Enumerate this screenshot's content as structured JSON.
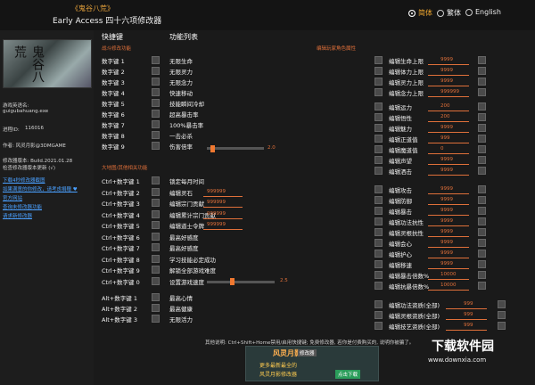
{
  "header": {
    "game_title": "《鬼谷八荒》",
    "subtitle": "Early Access 四十六项修改器",
    "langs": [
      {
        "label": "简体",
        "selected": true
      },
      {
        "label": "繁体",
        "selected": false
      },
      {
        "label": "English",
        "selected": false
      }
    ]
  },
  "sidebar": {
    "logo_text": "鬼谷八荒",
    "game_en_label": "游戏英语名:",
    "game_en_value": "guigubahuang.exe",
    "pid_label": "进程ID:",
    "pid_value": "116016",
    "author": "作者: 风灵月影@3DMGAME",
    "version": "修改器版本: Build.2021.01.28",
    "version_check": "检查修改器版本更新 (√)",
    "links": [
      "下载4秒修改器截图",
      "如果满意的你修改，请考虑捐赠 ♥",
      "官方网站",
      "查询未修改器功能",
      "请求新修改器"
    ]
  },
  "tabs": {
    "hotkeys": "快捷键",
    "features": "功能列表"
  },
  "sections": {
    "combat": "战斗修改功能",
    "player": "编辑玩家角色属性",
    "map": "大地图/其他相关功能"
  },
  "combat_keys": [
    "数字键 1",
    "数字键 2",
    "数字键 3",
    "数字键 4",
    "数字键 5",
    "数字键 6",
    "数字键 7",
    "数字键 8",
    "数字键 9"
  ],
  "combat_labels": [
    "无限生命",
    "无限灵力",
    "无限念力",
    "快速移动",
    "技能瞬间冷却",
    "超高暴击率",
    "100%暴击率",
    "一击必杀",
    "伤害倍率"
  ],
  "combat_slider_value": "2.0",
  "map_keys": [
    "Ctrl+数字键 1",
    "Ctrl+数字键 2",
    "Ctrl+数字键 3",
    "Ctrl+数字键 4",
    "Ctrl+数字键 5",
    "Ctrl+数字键 6",
    "Ctrl+数字键 7",
    "Ctrl+数字键 8",
    "Ctrl+数字键 9",
    "Ctrl+数字键 0"
  ],
  "map_labels": [
    "锁定每月时间",
    "编辑灵石",
    "编辑宗门贡献",
    "编辑累计宗门贡献",
    "编辑道士令牌",
    "最高好感度",
    "最高好感度",
    "学习技能必定成功",
    "解锁全部游戏难度",
    "设置游戏速度"
  ],
  "map_values": [
    "",
    "999999",
    "999999",
    "999999",
    "999999",
    "",
    "",
    "",
    "",
    ""
  ],
  "map_slider_value": "2.5",
  "alt_keys": [
    "Alt+数字键 1",
    "Alt+数字键 2",
    "Alt+数字键 3"
  ],
  "alt_labels": [
    "最高心情",
    "最高健康",
    "无限活力"
  ],
  "player_labels": [
    "编辑生命上限",
    "编辑体力上限",
    "编辑灵力上限",
    "编辑念力上限",
    "编辑运力",
    "编辑悟性",
    "编辑魅力",
    "编辑正道值",
    "编辑魔道值",
    "编辑声望",
    "编辑洒击",
    "编辑攻击",
    "编辑防御",
    "编辑暴击",
    "编辑功法抗性",
    "编辑灵根抗性",
    "编辑会心",
    "编辑护心",
    "编辑移速",
    "编辑暴击倍数%",
    "编辑抗暴倍数%",
    "编辑功法资质(全部)",
    "编辑灵根资质(全部)",
    "编辑技艺资质(全部)"
  ],
  "player_values": [
    "9999",
    "9999",
    "9999",
    "999999",
    "200",
    "200",
    "9999",
    "999",
    "0",
    "9999",
    "9999",
    "9999",
    "9999",
    "9999",
    "9999",
    "9999",
    "9999",
    "9999",
    "9999",
    "10000",
    "10000",
    "999",
    "999",
    "999"
  ],
  "footer": {
    "note": "其他说明: Ctrl+Shift+Home禁用/启用快捷键; 免费修改器, 若你是付费购买的, 说明你被骗了。",
    "ad_logo": "风灵月影",
    "ad_tag": "修改器",
    "ad_line1": "更多最新最全的",
    "ad_line2": "风灵月影修改器",
    "ad_btn": "点击下载"
  },
  "watermark": {
    "brand": "下载软件园",
    "url": "www.downxia.com"
  }
}
